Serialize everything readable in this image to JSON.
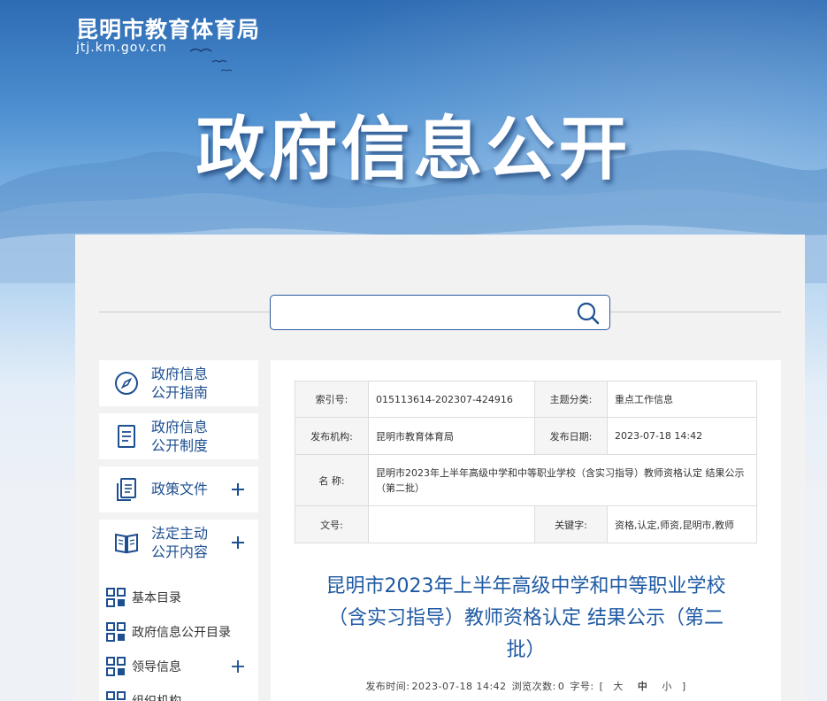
{
  "header": {
    "site_name": "昆明市教育体育局",
    "site_url": "jtj.km.gov.cn",
    "banner_title": "政府信息公开"
  },
  "search": {
    "value": "",
    "placeholder": ""
  },
  "nav": {
    "items": [
      {
        "label_line1": "政府信息",
        "label_line2": "公开指南",
        "icon": "compass-icon",
        "expandable": false
      },
      {
        "label_line1": "政府信息",
        "label_line2": "公开制度",
        "icon": "document-icon",
        "expandable": false
      },
      {
        "label_line1": "政策文件",
        "label_line2": "",
        "icon": "files-icon",
        "expandable": true
      },
      {
        "label_line1": "法定主动",
        "label_line2": "公开内容",
        "icon": "book-icon",
        "expandable": true
      }
    ],
    "sub_items": [
      {
        "label": "基本目录",
        "expandable": false
      },
      {
        "label": "政府信息公开目录",
        "expandable": false
      },
      {
        "label": "领导信息",
        "expandable": true
      },
      {
        "label": "组织机构",
        "expandable": false
      }
    ]
  },
  "meta_table": {
    "index_label": "索引号:",
    "index_value": "015113614-202307-424916",
    "topic_label": "主题分类:",
    "topic_value": "重点工作信息",
    "publisher_label": "发布机构:",
    "publisher_value": "昆明市教育体育局",
    "date_label": "发布日期:",
    "date_value": "2023-07-18 14:42",
    "name_label": "名 称:",
    "name_value": "昆明市2023年上半年高级中学和中等职业学校（含实习指导）教师资格认定 结果公示（第二批）",
    "docno_label": "文号:",
    "docno_value": "",
    "keyword_label": "关键字:",
    "keyword_value": "资格,认定,师资,昆明市,教师"
  },
  "article": {
    "title_line1": "昆明市2023年上半年高级中学和中等职业学校",
    "title_line2": "（含实习指导）教师资格认定 结果公示（第二",
    "title_line3": "批）",
    "publish_time_label": "发布时间:",
    "publish_time": "2023-07-18 14:42",
    "views_label": "浏览次数:",
    "views": "0",
    "font_size_label": "字号:",
    "bracket_open": "[",
    "size_large": "大",
    "size_medium": "中",
    "size_small": "小",
    "bracket_close": "]"
  },
  "colors": {
    "brand_blue": "#1d4f91",
    "title_blue": "#1f5aa3",
    "banner_top": "#2d6bb3"
  }
}
